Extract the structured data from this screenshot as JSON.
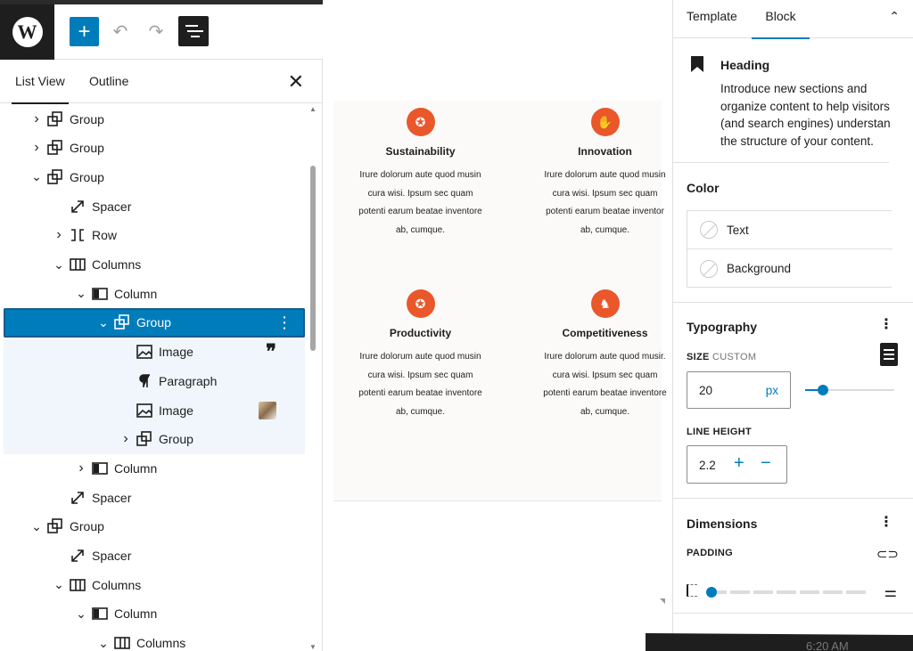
{
  "toolbar": {
    "logo_letter": "W",
    "add_symbol": "+",
    "undo_symbol": "↶",
    "redo_symbol": "↷"
  },
  "list_panel": {
    "tabs": [
      "List View",
      "Outline"
    ],
    "close_symbol": "✕",
    "rows": [
      {
        "label": "Group",
        "chev": "›",
        "icon": "group",
        "indent": 0
      },
      {
        "label": "Group",
        "chev": "›",
        "icon": "group",
        "indent": 0
      },
      {
        "label": "Group",
        "chev": "⌄",
        "icon": "group",
        "indent": 0
      },
      {
        "label": "Spacer",
        "chev": "",
        "icon": "spacer",
        "indent": 1
      },
      {
        "label": "Row",
        "chev": "›",
        "icon": "row",
        "indent": 1
      },
      {
        "label": "Columns",
        "chev": "⌄",
        "icon": "columns",
        "indent": 1
      },
      {
        "label": "Column",
        "chev": "⌄",
        "icon": "column",
        "indent": 2
      },
      {
        "label": "Group",
        "chev": "⌄",
        "icon": "group",
        "indent": 3,
        "selected": true
      },
      {
        "label": "Image",
        "chev": "",
        "icon": "image",
        "indent": 4,
        "light": true,
        "extra": "quote"
      },
      {
        "label": "Paragraph",
        "chev": "",
        "icon": "paragraph",
        "indent": 4,
        "light": true
      },
      {
        "label": "Image",
        "chev": "",
        "icon": "image",
        "indent": 4,
        "light": true,
        "extra": "thumb"
      },
      {
        "label": "Group",
        "chev": "›",
        "icon": "group",
        "indent": 4,
        "light": true
      },
      {
        "label": "Column",
        "chev": "›",
        "icon": "column",
        "indent": 2
      },
      {
        "label": "Spacer",
        "chev": "",
        "icon": "spacer",
        "indent": 1
      },
      {
        "label": "Group",
        "chev": "⌄",
        "icon": "group",
        "indent": 0
      },
      {
        "label": "Spacer",
        "chev": "",
        "icon": "spacer",
        "indent": 1
      },
      {
        "label": "Columns",
        "chev": "⌄",
        "icon": "columns",
        "indent": 1
      },
      {
        "label": "Column",
        "chev": "⌄",
        "icon": "column",
        "indent": 2
      },
      {
        "label": "Columns",
        "chev": "⌄",
        "icon": "columns",
        "indent": 3
      }
    ]
  },
  "canvas": {
    "cards": [
      {
        "title": "Sustainability",
        "text": [
          "Irure dolorum aute quod musin",
          "cura wisi. Ipsum sec quam",
          "potenti earum beatae inventore",
          "ab, cumque."
        ]
      },
      {
        "title": "Innovation",
        "text": [
          "Irure dolorum aute quod musin",
          "cura wisi. Ipsum sec quam",
          "potenti earum beatae inventor",
          "ab, cumque."
        ]
      },
      {
        "title": "Productivity",
        "text": [
          "Irure dolorum aute quod musin",
          "cura wisi. Ipsum sec quam",
          "potenti earum beatae inventore",
          "ab, cumque."
        ]
      },
      {
        "title": "Competitiveness",
        "text": [
          "Irure dolorum aute quod musir.",
          "cura wisi. Ipsum sec quam",
          "potenti earum beatae inventore",
          "ab, cumque."
        ]
      }
    ],
    "accent_color": "#e9572b"
  },
  "settings": {
    "tabs": {
      "template": "Template",
      "block": "Block"
    },
    "collapse_symbol": "⌃",
    "block_card": {
      "title": "Heading",
      "description": [
        "Introduce new sections and",
        "organize content to help visitors",
        "(and search engines) understan",
        "the structure of your content."
      ]
    },
    "color": {
      "title": "Color",
      "items": [
        "Text",
        "Background"
      ]
    },
    "typography": {
      "title": "Typography",
      "size_label": "SIZE",
      "size_mode": "CUSTOM",
      "size_value": "20",
      "size_unit": "px",
      "size_slider_fraction": 0.2,
      "line_height_label": "LINE HEIGHT",
      "line_height_value": "2.2",
      "plus": "+",
      "minus": "−"
    },
    "dimensions": {
      "title": "Dimensions",
      "padding_label": "PADDING",
      "padding_slider_fraction": 0
    },
    "kebab": "⋮",
    "bottom_time": "6:20 AM"
  },
  "colors": {
    "wp_blue": "#007cba",
    "dark": "#1e1e1e"
  }
}
